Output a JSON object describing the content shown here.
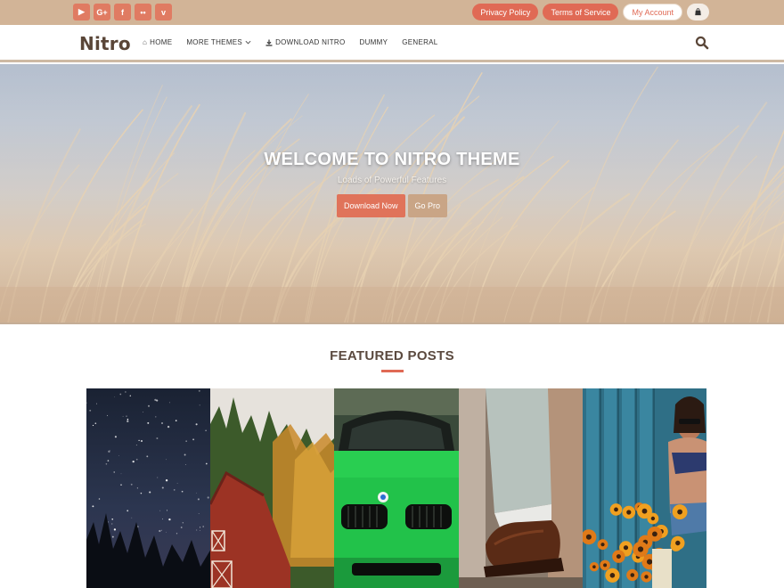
{
  "topbar": {
    "social": [
      {
        "icon": "youtube-icon",
        "glyph": "▶"
      },
      {
        "icon": "google-plus-icon",
        "glyph": "G+"
      },
      {
        "icon": "facebook-icon",
        "glyph": "f"
      },
      {
        "icon": "flickr-icon",
        "glyph": "••"
      },
      {
        "icon": "vimeo-icon",
        "glyph": "v"
      }
    ],
    "links": {
      "privacy": "Privacy Policy",
      "terms": "Terms of Service",
      "account": "My Account",
      "cart_icon": "shopping-bag-icon"
    }
  },
  "nav": {
    "logo": "Nitro",
    "items": [
      {
        "label": "HOME",
        "icon": "home-icon"
      },
      {
        "label": "MORE THEMES",
        "icon": "chevron-down-icon"
      },
      {
        "label": "DOWNLOAD NITRO",
        "icon": "download-icon"
      },
      {
        "label": "DUMMY"
      },
      {
        "label": "GENERAL"
      }
    ],
    "search_icon": "search-icon"
  },
  "hero": {
    "title": "WELCOME TO NITRO THEME",
    "subtitle": "Loads of Powerful Features",
    "primary_button": "Download Now",
    "secondary_button": "Go Pro"
  },
  "featured": {
    "title": "FEATURED POSTS",
    "posts": [
      "starry-night",
      "red-barn",
      "green-car",
      "leather-shoe",
      "flowers-fence"
    ]
  },
  "colors": {
    "accent": "#e06a55",
    "topbar": "#d2b497",
    "text_dark": "#5b4a3f"
  }
}
